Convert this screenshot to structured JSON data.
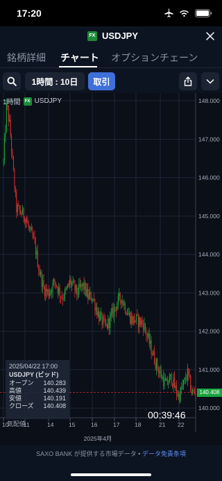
{
  "status": {
    "time": "17:20"
  },
  "header": {
    "badge": "FX",
    "symbol": "USDJPY"
  },
  "tabs": [
    {
      "label": "銘柄詳細",
      "active": false
    },
    {
      "label": "チャート",
      "active": true
    },
    {
      "label": "オプションチェーン",
      "active": false
    }
  ],
  "toolbar": {
    "timeframe_label": "1時間 : 10日",
    "trade_label": "取引"
  },
  "chart_header": {
    "timeframe": "1時間",
    "badge": "FX",
    "symbol": "USDJPY"
  },
  "info": {
    "date": "2025/04/22 17:00",
    "name": "USDJPY (ビッド)",
    "rows": [
      {
        "label": "オープン",
        "value": "140.283"
      },
      {
        "label": "高値",
        "value": "140.439"
      },
      {
        "label": "安値",
        "value": "140.191"
      },
      {
        "label": "クローズ",
        "value": "140.408"
      }
    ],
    "indicator": "気配値"
  },
  "countdown": "00:39:46",
  "last_price": "140.408",
  "footer": {
    "text": "SAXO BANK が提供する市場データ • ",
    "link": "データ免責条項"
  },
  "colors": {
    "up": "#19a33c",
    "down": "#d92b2b",
    "brand": "#3f6fd8"
  },
  "chart_data": {
    "type": "candlestick",
    "xlabel": "2025年4月",
    "x_ticks": [
      "10",
      "11",
      "14",
      "15",
      "16",
      "17",
      "18",
      "21",
      "22"
    ],
    "y_ticks": [
      148.0,
      147.0,
      146.0,
      145.0,
      144.0,
      143.0,
      142.0,
      141.0,
      140.0
    ],
    "ylim": [
      139.75,
      148.2
    ],
    "grid": true,
    "close_path": [
      [
        10,
        146.4
      ],
      [
        10.15,
        147.9
      ],
      [
        10.3,
        147.3
      ],
      [
        10.45,
        146.2
      ],
      [
        10.6,
        145.2
      ],
      [
        11,
        145.0
      ],
      [
        11.2,
        144.6
      ],
      [
        11.4,
        144.3
      ],
      [
        11.6,
        143.6
      ],
      [
        11.8,
        143.1
      ],
      [
        14,
        143.0
      ],
      [
        14.3,
        143.3
      ],
      [
        14.6,
        142.9
      ],
      [
        14.8,
        143.0
      ],
      [
        15,
        143.3
      ],
      [
        15.3,
        143.0
      ],
      [
        15.6,
        143.2
      ],
      [
        15.8,
        142.9
      ],
      [
        16,
        142.9
      ],
      [
        16.3,
        142.4
      ],
      [
        16.6,
        142.1
      ],
      [
        16.8,
        142.3
      ],
      [
        17,
        142.6
      ],
      [
        17.3,
        142.9
      ],
      [
        17.6,
        142.5
      ],
      [
        17.8,
        142.3
      ],
      [
        18,
        142.3
      ],
      [
        18.3,
        142.2
      ],
      [
        18.6,
        141.6
      ],
      [
        18.8,
        141.2
      ],
      [
        21,
        140.9
      ],
      [
        21.3,
        140.6
      ],
      [
        21.6,
        140.8
      ],
      [
        21.8,
        140.5
      ],
      [
        22,
        140.3
      ],
      [
        22.2,
        140.6
      ],
      [
        22.4,
        140.9
      ],
      [
        22.6,
        140.4
      ],
      [
        22.8,
        140.41
      ]
    ]
  }
}
